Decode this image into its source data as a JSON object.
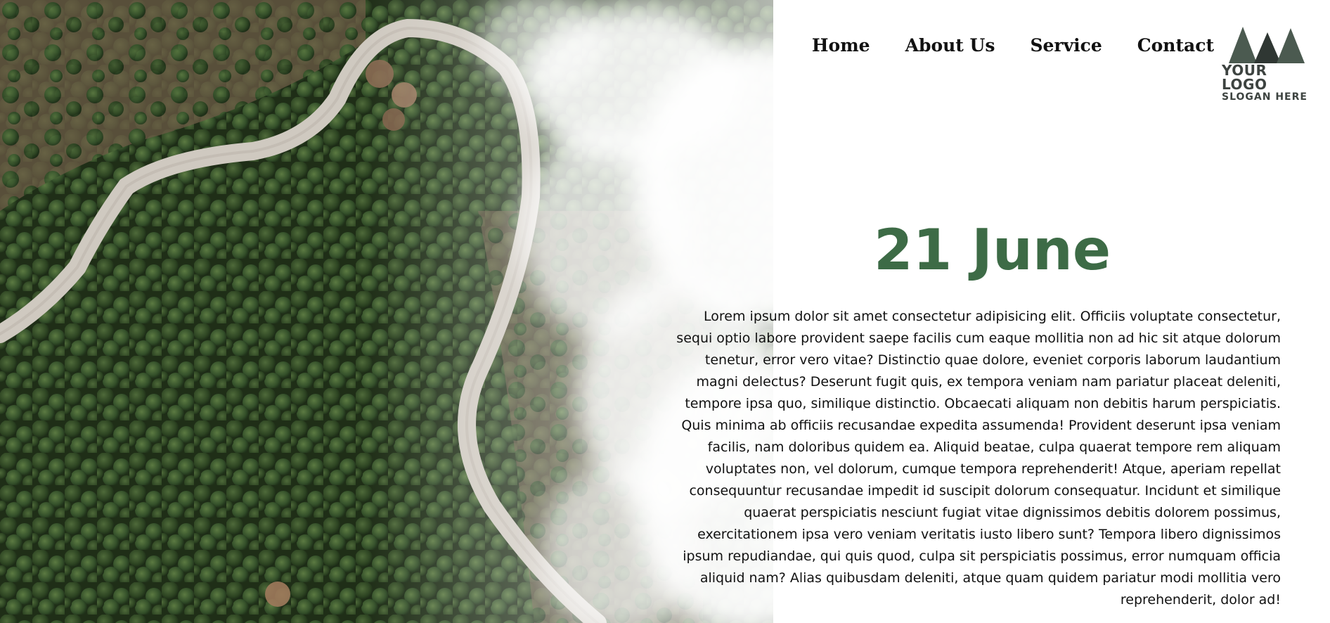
{
  "nav": {
    "items": [
      {
        "label": "Home"
      },
      {
        "label": "About Us"
      },
      {
        "label": "Service"
      },
      {
        "label": "Contact"
      }
    ]
  },
  "logo": {
    "title": "YOUR LOGO",
    "slogan": "SLOGAN HERE",
    "icon": "pine-trees-icon",
    "color": "#3d4340"
  },
  "hero": {
    "background": "aerial-forest-road-with-fog-photo",
    "title": "21 June",
    "title_color": "#3d6b46",
    "body": "Lorem ipsum dolor sit amet consectetur adipisicing elit. Officiis voluptate consectetur, sequi optio labore provident saepe facilis cum eaque mollitia non ad hic sit atque dolorum tenetur, error vero vitae? Distinctio quae dolore, eveniet corporis laborum laudantium magni delectus? Deserunt fugit quis, ex tempora veniam nam pariatur placeat deleniti, tempore ipsa quo, similique distinctio. Obcaecati aliquam non debitis harum perspiciatis. Quis minima ab officiis recusandae expedita assumenda! Provident deserunt ipsa veniam facilis, nam doloribus quidem ea. Aliquid beatae, culpa quaerat tempore rem aliquam voluptates non, vel dolorum, cumque tempora reprehenderit! Atque, aperiam repellat consequuntur recusandae impedit id suscipit dolorum consequatur. Incidunt et similique quaerat perspiciatis nesciunt fugiat vitae dignissimos debitis dolorem possimus, exercitationem ipsa vero veniam veritatis iusto libero sunt? Tempora libero dignissimos ipsum repudiandae, qui quis quod, culpa sit perspiciatis possimus, error numquam officia aliquid nam? Alias quibusdam deleniti, atque quam quidem pariatur modi mollitia vero reprehenderit, dolor ad!"
  }
}
